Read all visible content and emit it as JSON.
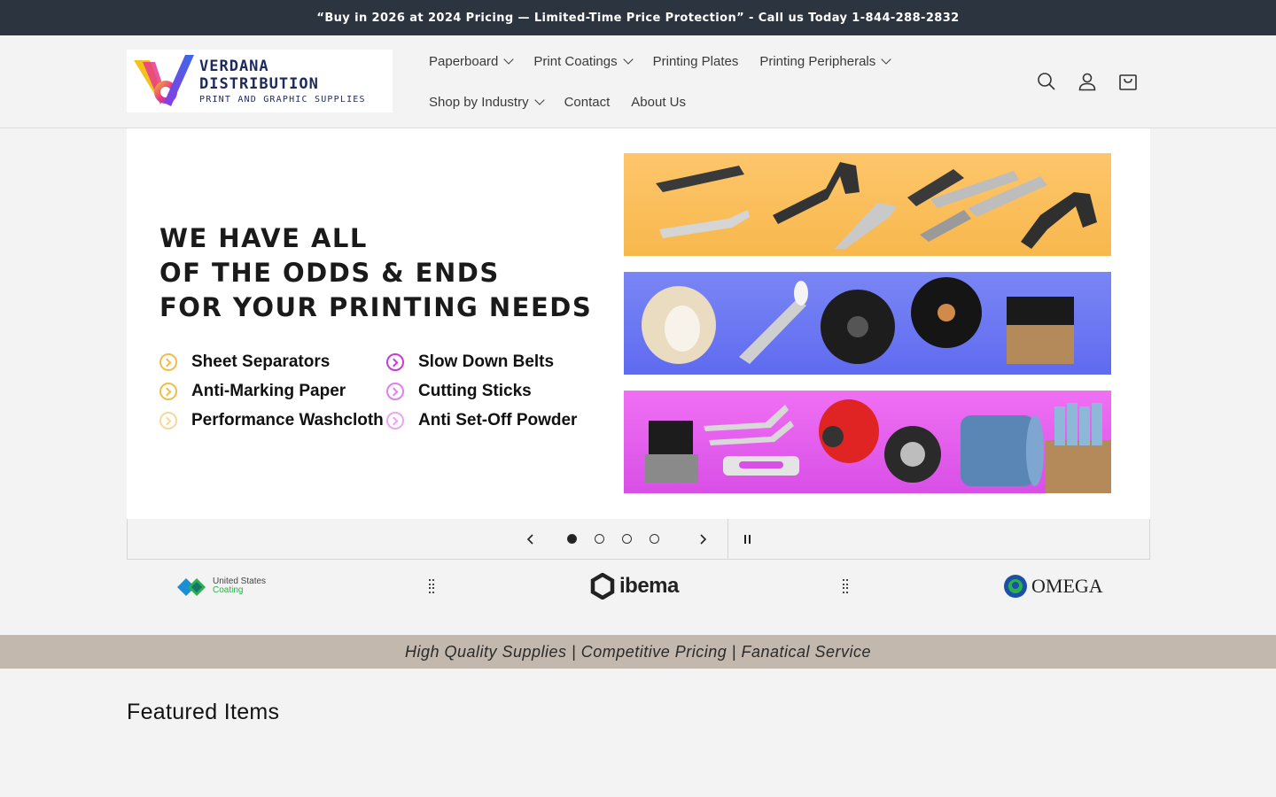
{
  "announcement": "“Buy in 2026 at 2024 Pricing — Limited-Time Price Protection” - Call us Today 1-844-288-2832",
  "logo": {
    "name": "VERDANA DISTRIBUTION",
    "tagline": "PRINT AND GRAPHIC SUPPLIES"
  },
  "nav": {
    "row1": [
      {
        "label": "Paperboard",
        "dropdown": true
      },
      {
        "label": "Print Coatings",
        "dropdown": true
      },
      {
        "label": "Printing Plates",
        "dropdown": false
      },
      {
        "label": "Printing Peripherals",
        "dropdown": true
      }
    ],
    "row2": [
      {
        "label": "Shop by Industry",
        "dropdown": true
      },
      {
        "label": "Contact",
        "dropdown": false
      },
      {
        "label": "About Us",
        "dropdown": false
      }
    ]
  },
  "header_icons": [
    "search-icon",
    "account-icon",
    "cart-icon"
  ],
  "hero": {
    "headline": [
      "WE HAVE ALL",
      "OF THE ODDS & ENDS",
      "FOR YOUR PRINTING NEEDS"
    ],
    "items": [
      {
        "label": "Sheet Separators",
        "color": "#f1bd4c"
      },
      {
        "label": "Slow Down Belts",
        "color": "#c63bd6"
      },
      {
        "label": "Anti-Marking Paper",
        "color": "#f1bd4c"
      },
      {
        "label": "Cutting Sticks",
        "color": "#e080ea"
      },
      {
        "label": "Performance Washcloth",
        "color": "#f6d99a"
      },
      {
        "label": "Anti Set-Off Powder",
        "color": "#eda4f2"
      }
    ],
    "panel_colors": [
      "#fec66b",
      "#6b77f2",
      "#e35ff0"
    ]
  },
  "slider": {
    "total_slides": 4,
    "active_slide": 1
  },
  "brands": [
    {
      "name": "United States Coating",
      "line1": "United States",
      "line2": "Coating"
    },
    {
      "name": "ibema",
      "label": "ibema"
    },
    {
      "name": "OMEGA",
      "label": "OMEGA"
    }
  ],
  "tagline": "High Quality Supplies | Competitive Pricing | Fanatical Service",
  "featured_title": "Featured Items",
  "colors": {
    "announcement_bg": "#2c3440",
    "tagline_bg": "#c3b8ad",
    "page_bg": "#f3f3f3"
  }
}
